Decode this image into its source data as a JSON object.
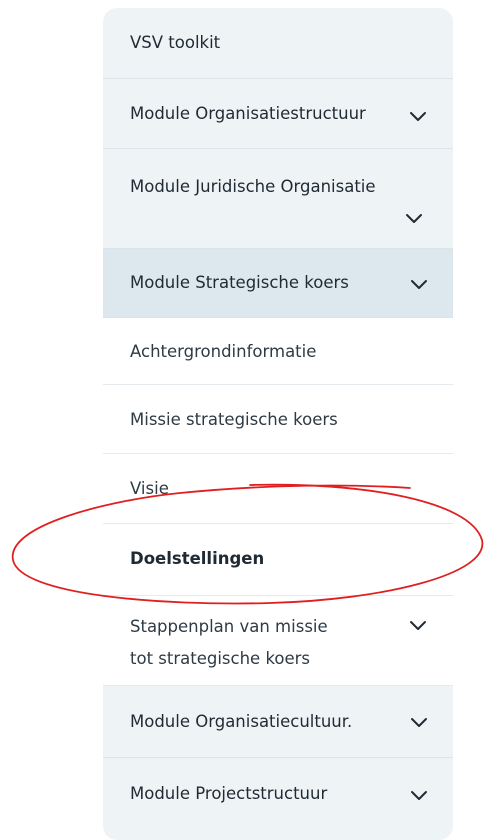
{
  "nav": {
    "title": "VSV toolkit",
    "items": [
      {
        "label": "Module Organisatiestructuur"
      },
      {
        "label": "Module Juridische Organisatie"
      },
      {
        "label": "Module Strategische koers"
      },
      {
        "label": "Achtergrondinformatie"
      },
      {
        "label": "Missie strategische koers"
      },
      {
        "label": "Visie"
      },
      {
        "label": "Doelstellingen"
      },
      {
        "label_line1": "Stappenplan van missie",
        "label_line2": "tot strategische koers"
      },
      {
        "label": "Module Organisatiecultuur."
      },
      {
        "label": "Module Projectstructuur"
      }
    ]
  },
  "colors": {
    "top_level_bg": "#eef3f6",
    "active_bg": "#dce8ee",
    "sub_bg": "#ffffff",
    "annotation_circle": "#e02020"
  },
  "icons": {
    "expand": "chevron-down-icon"
  }
}
